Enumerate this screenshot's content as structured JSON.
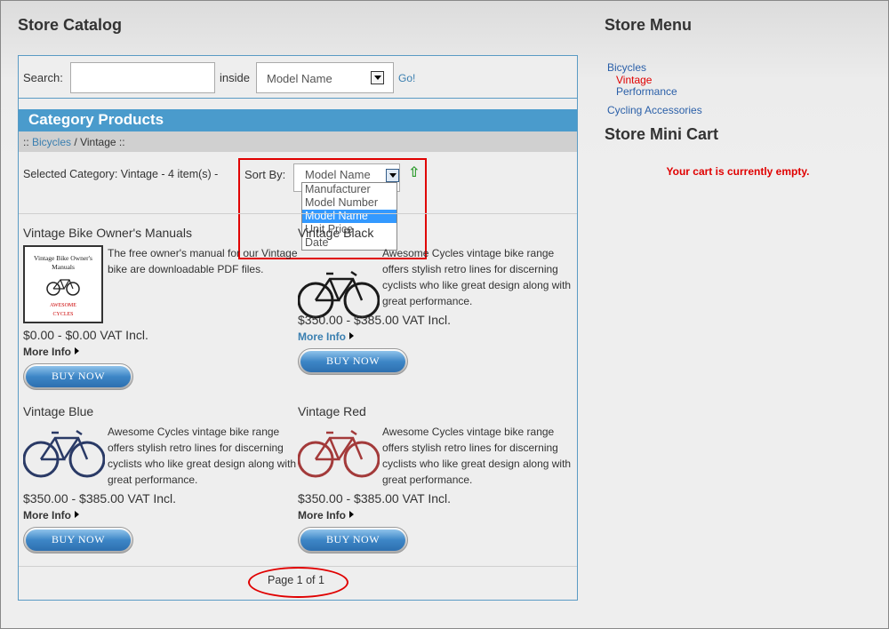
{
  "catalog": {
    "title": "Store Catalog",
    "search_label": "Search:",
    "search_value": "",
    "inside_label": "inside",
    "field_selected": "Model Name",
    "go_label": "Go!",
    "category_header": "Category Products",
    "breadcrumb": {
      "prefix": "::",
      "parent": "Bicycles",
      "separator": "/",
      "current": "Vintage",
      "suffix": "::"
    },
    "selected_category": "Selected Category: Vintage - 4 item(s) -",
    "sort_label": "Sort By:",
    "sort_selected": "Model Name",
    "sort_options": [
      "Manufacturer",
      "Model Number",
      "Model Name",
      "Unit Price",
      "Date"
    ],
    "sort_selected_index": 2,
    "sort_toggle_icon": "green-up-arrow-icon",
    "pager": "Page 1 of 1"
  },
  "products": [
    {
      "title": "Vintage Bike Owner's Manuals",
      "description": "The free owner's manual for our Vintage bike are downloadable PDF files.",
      "price": "$0.00 - $0.00 VAT Incl.",
      "more_info": "More Info",
      "buy": "BUY NOW",
      "cover_title": "Vintage Bike Owner's Manuals",
      "brand": "AWESOME",
      "brand_sub": "CYCLES",
      "bike_color": "#222222"
    },
    {
      "title": "Vintage Black",
      "description": "Awesome Cycles vintage bike range offers stylish retro lines for discerning cyclists who like great design along with great performance.",
      "price": "$350.00 - $385.00 VAT Incl.",
      "more_info": "More Info",
      "buy": "BUY NOW",
      "bike_color": "#1a1a1a"
    },
    {
      "title": "Vintage Blue",
      "description": "Awesome Cycles vintage bike range offers stylish retro lines for discerning cyclists who like great design along with great performance.",
      "price": "$350.00 - $385.00 VAT Incl.",
      "more_info": "More Info",
      "buy": "BUY NOW",
      "bike_color": "#2a3a66"
    },
    {
      "title": "Vintage Red",
      "description": "Awesome Cycles vintage bike range offers stylish retro lines for discerning cyclists who like great design along with great performance.",
      "price": "$350.00 - $385.00 VAT Incl.",
      "more_info": "More Info",
      "buy": "BUY NOW",
      "bike_color": "#a33a3a"
    }
  ],
  "menu": {
    "title": "Store Menu",
    "items": [
      "Bicycles",
      "Vintage",
      "Performance",
      "Cycling Accessories"
    ],
    "active_item": "Vintage"
  },
  "mini_cart": {
    "title": "Store Mini Cart",
    "empty_text": "Your cart is currently empty."
  },
  "colors": {
    "accent_blue": "#4a9bcc",
    "link_blue": "#3a7fb0",
    "alert_red": "#e00000"
  }
}
